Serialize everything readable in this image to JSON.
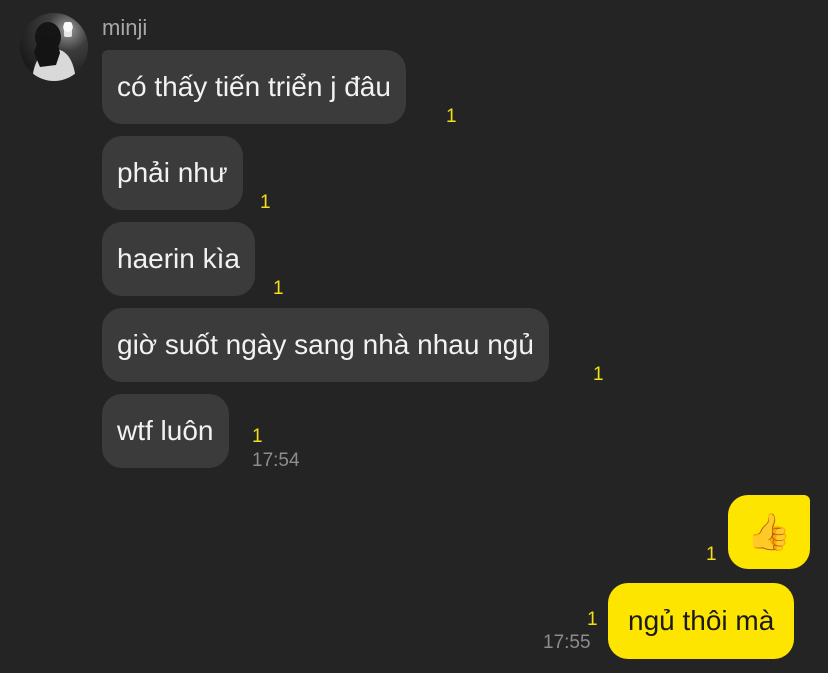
{
  "chat": {
    "sender": {
      "name": "minji",
      "avatar_icon": "profile-photo"
    },
    "incoming": [
      {
        "text": "có thấy tiến triển j đâu",
        "unread": "1"
      },
      {
        "text": "phải như",
        "unread": "1"
      },
      {
        "text": "haerin kìa",
        "unread": "1"
      },
      {
        "text": "giờ suốt ngày sang nhà nhau ngủ",
        "unread": "1"
      },
      {
        "text": "wtf luôn",
        "unread": "1",
        "time": "17:54"
      }
    ],
    "outgoing": [
      {
        "text": "👍",
        "unread": "1",
        "icon": "thumbs-up-emoji"
      },
      {
        "text": "ngủ thôi mà",
        "unread": "1",
        "time": "17:55"
      }
    ]
  },
  "colors": {
    "background": "#242424",
    "incoming_bubble": "#3b3b3b",
    "outgoing_bubble": "#fee500",
    "unread_count": "#f3df16",
    "timestamp": "#8d8d8d"
  }
}
